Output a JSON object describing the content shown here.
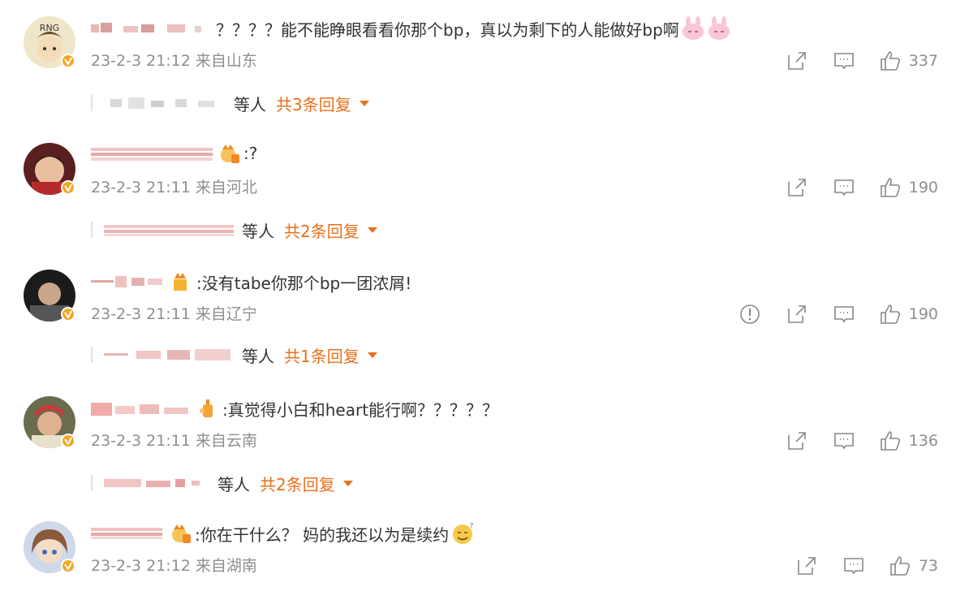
{
  "comments": [
    {
      "text": "？？？？能不能睁眼看看你那个bp，真以为剩下的人能做好bp啊",
      "time": "23-2-3 21:12",
      "location": "来自山东",
      "likes": "337",
      "reply_etc": "等人",
      "reply_count": "共3条回复"
    },
    {
      "text": ":?",
      "time": "23-2-3 21:11",
      "location": "来自河北",
      "likes": "190",
      "reply_etc": "等人",
      "reply_count": "共2条回复"
    },
    {
      "text": ":没有tabe你那个bp一团浓屑!",
      "time": "23-2-3 21:11",
      "location": "来自辽宁",
      "likes": "190",
      "reply_etc": "等人",
      "reply_count": "共1条回复"
    },
    {
      "text": ":真觉得小白和heart能行啊？？？？？",
      "time": "23-2-3 21:11",
      "location": "来自云南",
      "likes": "136",
      "reply_etc": "等人",
      "reply_count": "共2条回复"
    },
    {
      "text": ":你在干什么？ 妈的我还以为是续约",
      "time": "23-2-3 21:12",
      "location": "来自湖南",
      "likes": "73"
    }
  ],
  "avatar_text_1": "RNG",
  "icons": {
    "share": "share-icon",
    "comment": "comment-icon",
    "like": "like-icon",
    "report": "report-icon",
    "verified": "verified-badge-icon",
    "crown": "fan-crown-icon",
    "expand": "caret-down-icon"
  },
  "colors": {
    "accent": "#e96f1b",
    "meta": "#8f8f8f",
    "text": "#333333",
    "badge": "#f5a623"
  }
}
